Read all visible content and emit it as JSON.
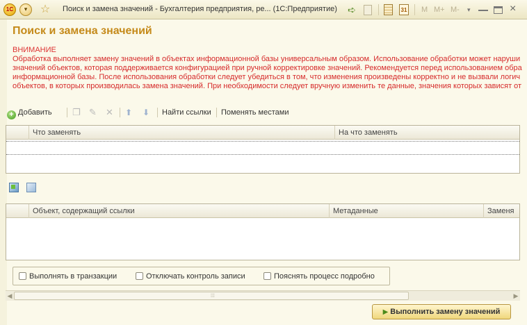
{
  "window": {
    "logo_text": "1С",
    "title": "Поиск и замена значений - Бухгалтерия предприятия, ре...  (1С:Предприятие)",
    "calendar_day": "31",
    "m": "M",
    "m_plus": "M+",
    "m_minus": "M-"
  },
  "form": {
    "title": "Поиск и замена значений",
    "warning_heading": "ВНИМАНИЕ",
    "warning_lines": [
      "Обработка выполняет замену значений в объектах информационной базы универсальным образом.  Использование обработки может наруши",
      "значений объектов, которая поддерживается конфигурацией при ручной корректировке значений. Рекомендуется перед использованием обра",
      "информационной базы. После использования обработки следует убедиться в том, что изменения произведены корректно и не вызвали логич",
      "объектов, в которых производилась замена значений. При необходимости следует вручную изменить те данные, значения которых зависят от"
    ]
  },
  "toolbar": {
    "add_label": "Добавить",
    "find_links_label": "Найти ссылки",
    "swap_label": "Поменять местами"
  },
  "replace_table": {
    "columns": [
      "Что заменять",
      "На что заменять"
    ]
  },
  "refs_table": {
    "columns": [
      "Объект, содержащий ссылки",
      "Метаданные",
      "Заменя"
    ]
  },
  "options": {
    "in_transaction": "Выполнять в транзакции",
    "disable_write_control": "Отключать контроль записи",
    "verbose": "Пояснять процесс подробно"
  },
  "actions": {
    "run_label": "Выполнить замену значений"
  }
}
